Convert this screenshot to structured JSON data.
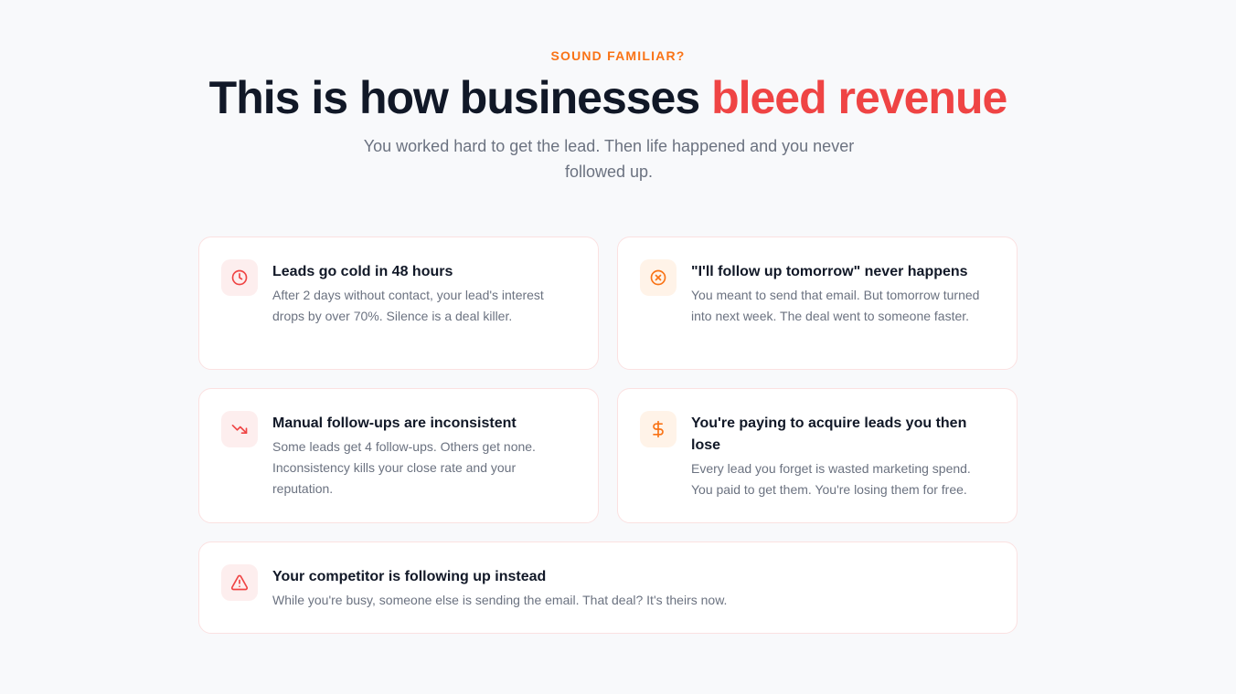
{
  "section": {
    "eyebrow": "SOUND FAMILIAR?",
    "headline_main": "This is how businesses ",
    "headline_accent": "bleed revenue",
    "subtitle": "You worked hard to get the lead. Then life happened and you never followed up."
  },
  "colors": {
    "accent_red": "#ef4444",
    "accent_orange": "#f97316",
    "heading": "#111827",
    "body": "#6b7280"
  },
  "cards": [
    {
      "icon": "clock-icon",
      "title": "Leads go cold in 48 hours",
      "body": "After 2 days without contact, your lead's interest drops by over 70%. Silence is a deal killer."
    },
    {
      "icon": "x-circle-icon",
      "title": "\"I'll follow up tomorrow\" never happens",
      "body": "You meant to send that email. But tomorrow turned into next week. The deal went to someone faster."
    },
    {
      "icon": "trending-down-icon",
      "title": "Manual follow-ups are inconsistent",
      "body": "Some leads get 4 follow-ups. Others get none. Inconsistency kills your close rate and your reputation."
    },
    {
      "icon": "dollar-sign-icon",
      "title": "You're paying to acquire leads you then lose",
      "body": "Every lead you forget is wasted marketing spend. You paid to get them. You're losing them for free."
    },
    {
      "icon": "alert-triangle-icon",
      "title": "Your competitor is following up instead",
      "body": "While you're busy, someone else is sending the email. That deal? It's theirs now."
    }
  ]
}
